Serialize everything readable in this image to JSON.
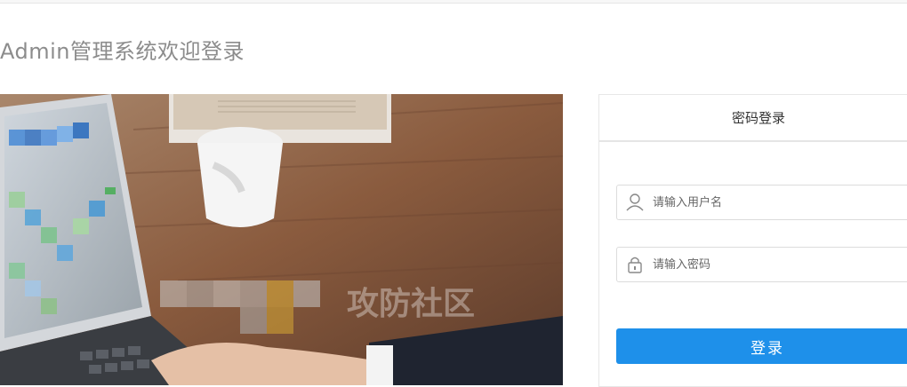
{
  "page": {
    "title": "Admin管理系统欢迎登录"
  },
  "hero": {
    "watermark": "攻防社区"
  },
  "login": {
    "tab_label": "密码登录",
    "username_placeholder": "请输入用户名",
    "password_placeholder": "请输入密码",
    "submit_label": "登录"
  },
  "icons": {
    "username": "user-icon",
    "password": "lock-icon"
  },
  "colors": {
    "accent": "#1e90ea",
    "title": "#8c8c8c"
  }
}
